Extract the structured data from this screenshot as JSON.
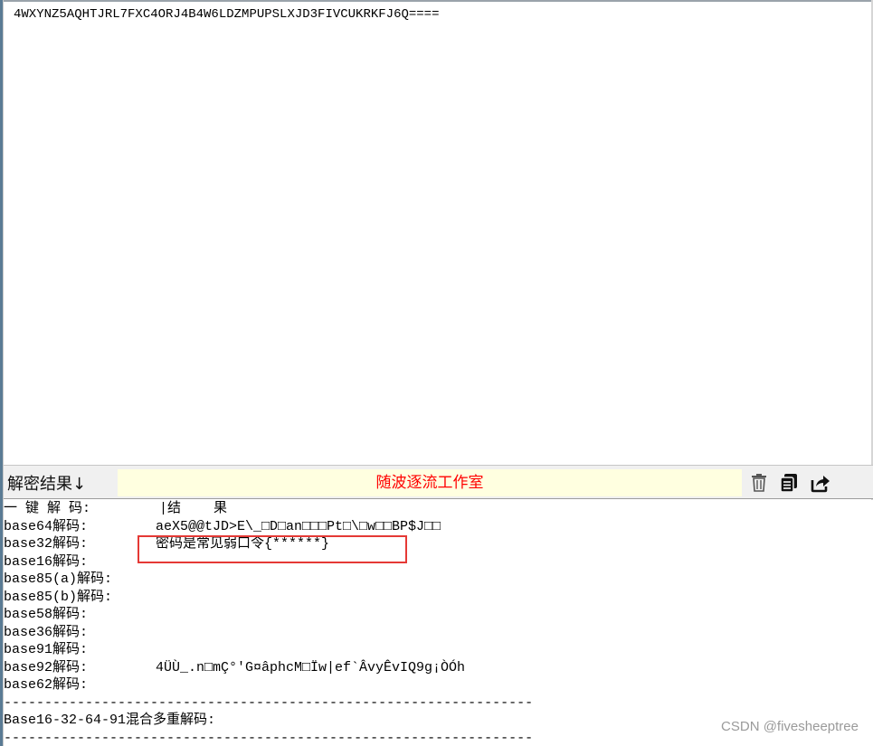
{
  "input": {
    "text": "4WXYNZ5AQHTJRL7FXC4ORJ4B4W6LDZMPUPSLXJD3FIVCUKRKFJ6Q===="
  },
  "toolbar": {
    "label": "解密结果↓",
    "banner": "随波逐流工作室",
    "icons": [
      "trash-icon",
      "copy-icon",
      "share-icon"
    ]
  },
  "output": {
    "header": {
      "label": "一 键 解 码:",
      "value": "|结    果"
    },
    "rows": [
      {
        "label": "base64解码:",
        "value": "aeX5@@tJD>E\\_□D□an□□□Pt□\\□w□□BP$J□□"
      },
      {
        "label": "base32解码:",
        "value": "密码是常见弱口令{******}"
      },
      {
        "label": "base16解码:",
        "value": ""
      },
      {
        "label": "base85(a)解码:",
        "value": ""
      },
      {
        "label": "base85(b)解码:",
        "value": ""
      },
      {
        "label": "base58解码:",
        "value": ""
      },
      {
        "label": "base36解码:",
        "value": ""
      },
      {
        "label": "base91解码:",
        "value": ""
      },
      {
        "label": "base92解码:",
        "value": "4ÜÙ_.n□mÇ°'G¤âphcM□Ïw|ef`ÂvyÊvIQ9g¡ÒÓh"
      },
      {
        "label": "base62解码:",
        "value": ""
      }
    ],
    "divider": "-----------------------------------------------------------------",
    "mixed_label": "Base16-32-64-91混合多重解码:",
    "divider2": "-----------------------------------------------------------------"
  },
  "watermark": "CSDN @fivesheeptree",
  "colors": {
    "banner_bg": "#ffffe0",
    "banner_text": "#ff0000",
    "highlight": "#e53935"
  }
}
